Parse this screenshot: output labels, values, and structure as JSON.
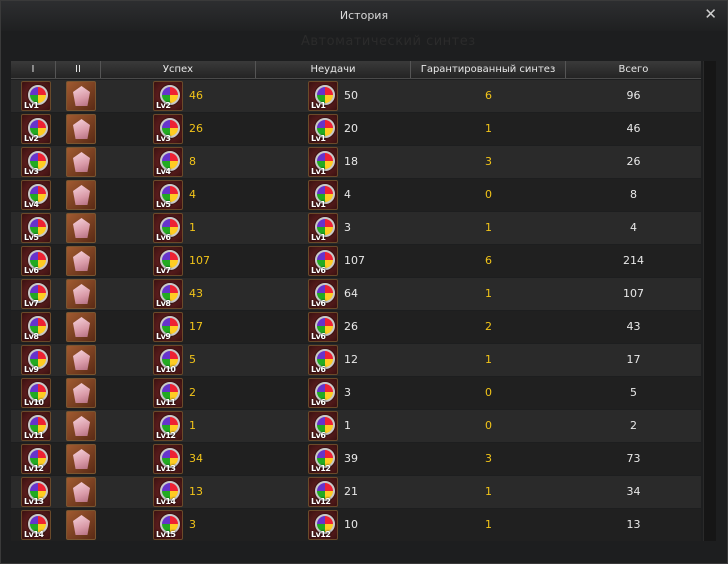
{
  "window": {
    "title": "История",
    "ghost_heading": "Автоматический синтез"
  },
  "columns": {
    "c1": "I",
    "c2": "II",
    "c3": "Успех",
    "c4": "Неудачи",
    "c5": "Гарантированный синтез",
    "c6": "Всего"
  },
  "rows": [
    {
      "l1": "Lv1",
      "sl": "Lv2",
      "s": "46",
      "fl": "Lv1",
      "f": "50",
      "g": "6",
      "t": "96"
    },
    {
      "l1": "Lv2",
      "sl": "Lv3",
      "s": "26",
      "fl": "Lv1",
      "f": "20",
      "g": "1",
      "t": "46"
    },
    {
      "l1": "Lv3",
      "sl": "Lv4",
      "s": "8",
      "fl": "Lv1",
      "f": "18",
      "g": "3",
      "t": "26"
    },
    {
      "l1": "Lv4",
      "sl": "Lv5",
      "s": "4",
      "fl": "Lv1",
      "f": "4",
      "g": "0",
      "t": "8"
    },
    {
      "l1": "Lv5",
      "sl": "Lv6",
      "s": "1",
      "fl": "Lv1",
      "f": "3",
      "g": "1",
      "t": "4"
    },
    {
      "l1": "Lv6",
      "sl": "Lv7",
      "s": "107",
      "fl": "Lv6",
      "f": "107",
      "g": "6",
      "t": "214"
    },
    {
      "l1": "Lv7",
      "sl": "Lv8",
      "s": "43",
      "fl": "Lv6",
      "f": "64",
      "g": "1",
      "t": "107"
    },
    {
      "l1": "Lv8",
      "sl": "Lv9",
      "s": "17",
      "fl": "Lv6",
      "f": "26",
      "g": "2",
      "t": "43"
    },
    {
      "l1": "Lv9",
      "sl": "Lv10",
      "s": "5",
      "fl": "Lv6",
      "f": "12",
      "g": "1",
      "t": "17"
    },
    {
      "l1": "Lv10",
      "sl": "Lv11",
      "s": "2",
      "fl": "Lv6",
      "f": "3",
      "g": "0",
      "t": "5"
    },
    {
      "l1": "Lv11",
      "sl": "Lv12",
      "s": "1",
      "fl": "Lv6",
      "f": "1",
      "g": "0",
      "t": "2"
    },
    {
      "l1": "Lv12",
      "sl": "Lv13",
      "s": "34",
      "fl": "Lv12",
      "f": "39",
      "g": "3",
      "t": "73"
    },
    {
      "l1": "Lv13",
      "sl": "Lv14",
      "s": "13",
      "fl": "Lv12",
      "f": "21",
      "g": "1",
      "t": "34"
    },
    {
      "l1": "Lv14",
      "sl": "Lv15",
      "s": "3",
      "fl": "Lv12",
      "f": "10",
      "g": "1",
      "t": "13"
    }
  ],
  "colors": {
    "yellow": "#f2c419",
    "white": "#e8e8e8"
  },
  "icons": {
    "material_1": "rune-orb-icon",
    "material_2": "pink-crystal-icon",
    "close": "close-icon"
  }
}
